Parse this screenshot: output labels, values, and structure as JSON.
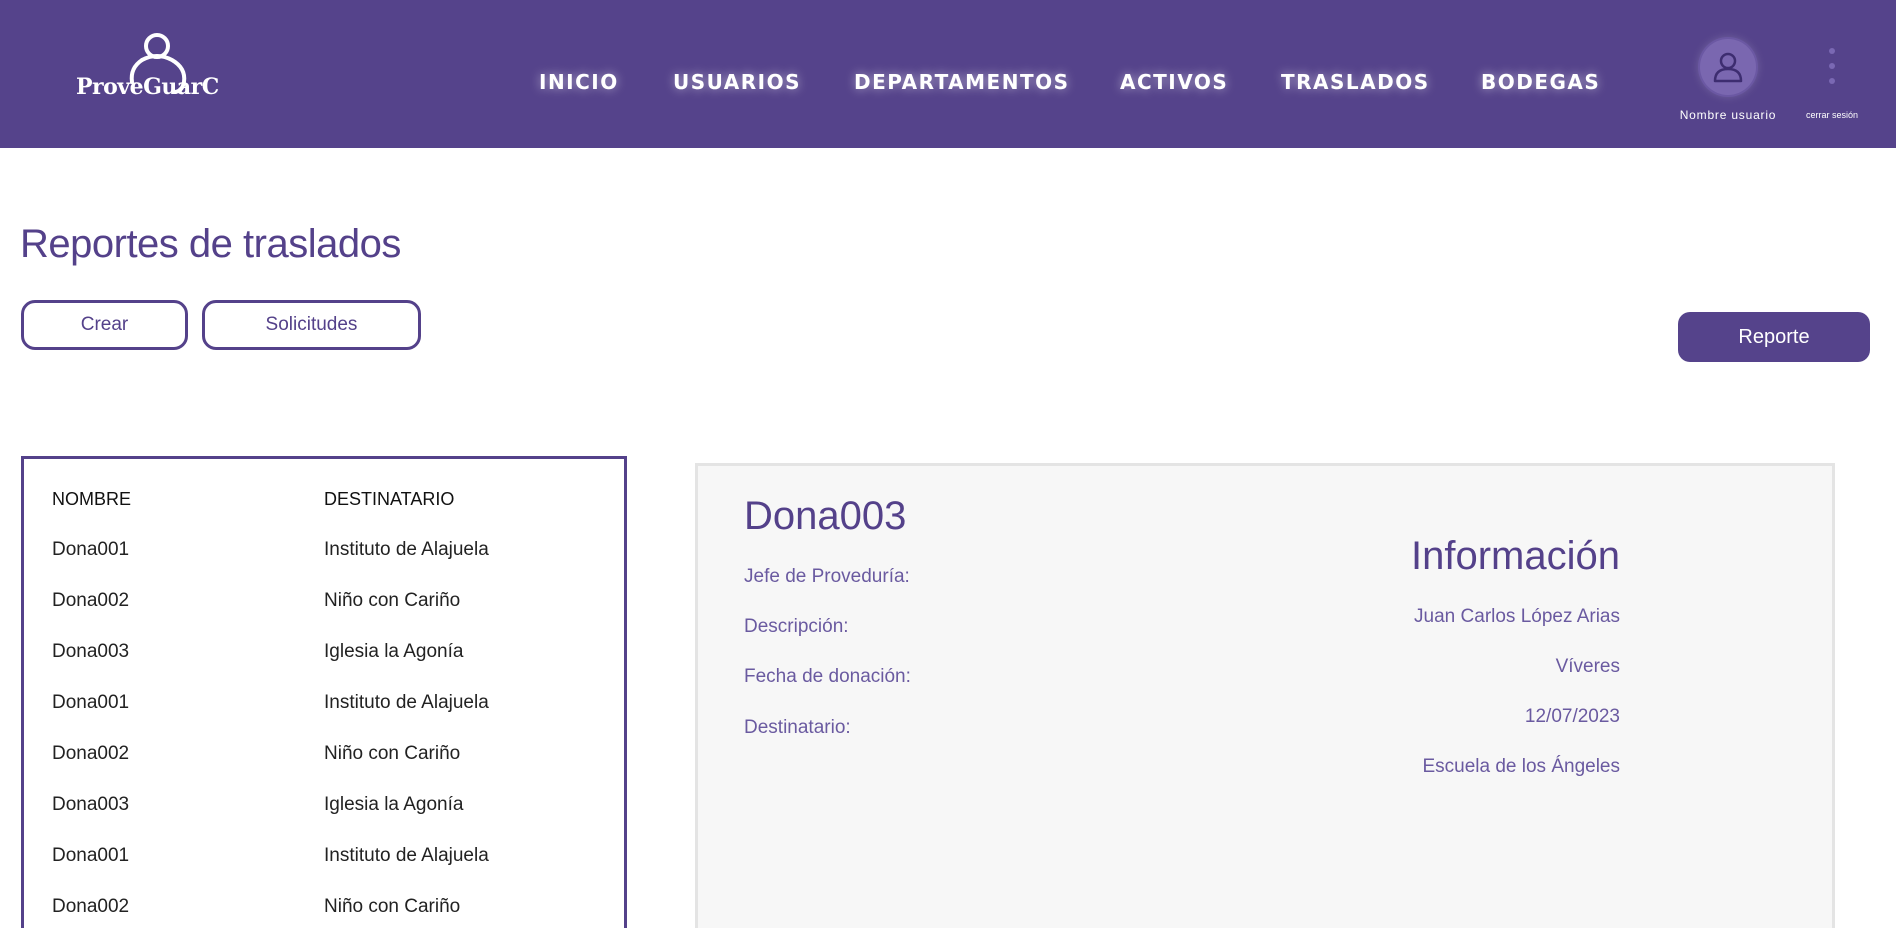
{
  "header": {
    "logo_text": "ProveGuarC",
    "nav": [
      "INICIO",
      "USUARIOS",
      "DEPARTAMENTOS",
      "ACTIVOS",
      "TRASLADOS",
      "BODEGAS"
    ],
    "user_name": "Nombre usuario",
    "logout_label": "cerrar sesión"
  },
  "page": {
    "title": "Reportes de traslados",
    "buttons": {
      "create": "Crear",
      "requests": "Solicitudes",
      "report": "Reporte"
    }
  },
  "table": {
    "headers": [
      "NOMBRE",
      "DESTINATARIO"
    ],
    "rows": [
      [
        "Dona001",
        "Instituto de Alajuela"
      ],
      [
        "Dona002",
        "Niño con Cariño"
      ],
      [
        "Dona003",
        "Iglesia la Agonía"
      ],
      [
        "Dona001",
        "Instituto de Alajuela"
      ],
      [
        "Dona002",
        "Niño con Cariño"
      ],
      [
        "Dona003",
        "Iglesia la Agonía"
      ],
      [
        "Dona001",
        "Instituto de Alajuela"
      ],
      [
        "Dona002",
        "Niño con Cariño"
      ]
    ]
  },
  "detail": {
    "title": "Dona003",
    "info_title": "Información",
    "labels": [
      "Jefe de Proveduría:",
      "Descripción:",
      "Fecha de donación:",
      "Destinatario:"
    ],
    "values": [
      "Juan Carlos López Arias",
      "Víveres",
      "12/07/2023",
      "Escuela de los Ángeles"
    ]
  },
  "colors": {
    "brand": "#55438b",
    "panel": "#f7f7f7",
    "white": "#ffffff"
  },
  "icons": [
    "user-icon",
    "kebab-menu-icon"
  ]
}
